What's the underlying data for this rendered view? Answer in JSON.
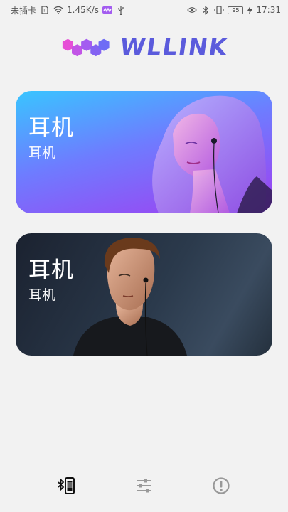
{
  "status_bar": {
    "carrier": "未插卡",
    "network_speed": "1.45K/s",
    "battery_level": "95",
    "time": "17:31",
    "icons": [
      "sim-icon",
      "wifi-icon",
      "app-notify-icon",
      "usb-icon",
      "eye-icon",
      "bluetooth-icon",
      "vibrate-icon",
      "battery-icon",
      "charging-icon"
    ]
  },
  "logo": {
    "text": "WLLINK",
    "brand_color": "#5b5bdc",
    "mark_colors": [
      "#e64fd6",
      "#a35cf0",
      "#6f6cf5"
    ]
  },
  "cards": [
    {
      "title": "耳机",
      "subtitle": "耳机",
      "theme": "blue-purple-gradient",
      "image": "woman-with-earphones"
    },
    {
      "title": "耳机",
      "subtitle": "耳机",
      "theme": "dark-slate",
      "image": "man-with-earphones"
    }
  ],
  "bottom_nav": {
    "items": [
      {
        "name": "bluetooth-device-tab",
        "icon": "bluetooth-phone-icon",
        "active": true
      },
      {
        "name": "equalizer-tab",
        "icon": "sliders-icon",
        "active": false
      },
      {
        "name": "about-tab",
        "icon": "info-circle-icon",
        "active": false
      }
    ]
  }
}
